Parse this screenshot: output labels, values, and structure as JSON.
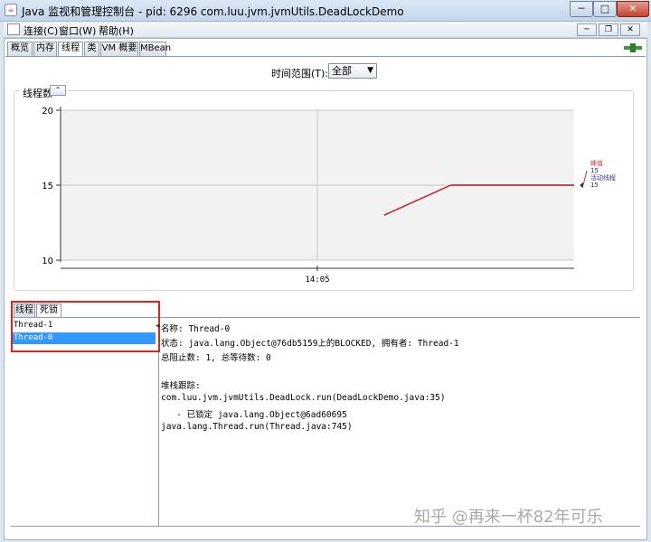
{
  "window": {
    "title": "Java 监视和管理控制台 - pid: 6296 com.luu.jvm.jvmUtils.DeadLockDemo",
    "app_icon": "java-app-icon",
    "minimize_label": "─",
    "maximize_label": "□",
    "close_label": "✕"
  },
  "menu": {
    "connect": "连接(C)",
    "window": "窗口(W)",
    "help": "帮助(H)",
    "mdi_min": "─",
    "mdi_max": "❐",
    "mdi_close": "✕"
  },
  "tabs": [
    "概览",
    "内存",
    "线程",
    "类",
    "VM 概要",
    "MBean"
  ],
  "selected_tab": "线程",
  "time_range": {
    "label": "时间范围(T):",
    "value": "全部",
    "arrow": "▼"
  },
  "chart_panel": {
    "title": "线程数",
    "collapse_icon": "⌃"
  },
  "chart_data": {
    "type": "line",
    "x": [
      "14:05"
    ],
    "ylim": [
      10,
      20
    ],
    "yticks": [
      10,
      15,
      20
    ],
    "series": [
      {
        "name": "峰值",
        "color": "#cc3333",
        "points": [
          [
            0.63,
            13
          ],
          [
            0.76,
            15
          ],
          [
            1.0,
            15
          ]
        ],
        "last_value": "15"
      },
      {
        "name": "活动线程",
        "color": "#333399",
        "points": [
          [
            0.63,
            13
          ],
          [
            0.76,
            15
          ],
          [
            1.0,
            15
          ]
        ],
        "last_value": "15"
      }
    ],
    "grid": true,
    "legend": "right"
  },
  "lower_tabs": [
    "线程",
    "死锁"
  ],
  "selected_lower_tab": "死锁",
  "threads": [
    "Thread-1",
    "Thread-0"
  ],
  "selected_thread": "Thread-0",
  "splitter_mark": "◂",
  "detail": {
    "name_line": "名称: Thread-0",
    "state_line": "状态: java.lang.Object@76db5159上的BLOCKED, 拥有者: Thread-1",
    "counts_line": "总阻止数: 1, 总等待数: 0",
    "stack_label": "堆栈跟踪:",
    "stack": [
      "com.luu.jvm.jvmUtils.DeadLock.run(DeadLockDemo.java:35)",
      "   - 已锁定 java.lang.Object@6ad60695",
      "java.lang.Thread.run(Thread.java:745)"
    ]
  },
  "watermark": "知乎 @再来一杯82年可乐"
}
